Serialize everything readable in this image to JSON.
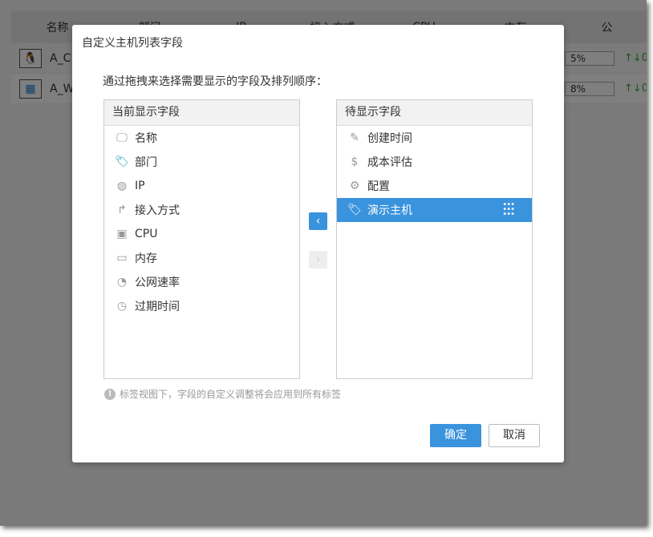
{
  "background": {
    "headers": [
      "名称",
      "部门",
      "IP",
      "接入方式",
      "CPU",
      "内存",
      "公"
    ],
    "rows": [
      {
        "name": "A_C",
        "os": "linux-icon",
        "mem": "5%",
        "net": "↑↓0"
      },
      {
        "name": "A_W",
        "os": "windows-icon",
        "mem": "8%",
        "net": "↑↓0"
      }
    ]
  },
  "dialog": {
    "title": "自定义主机列表字段",
    "instruction": "通过拖拽来选择需要显示的字段及排列顺序：",
    "current": {
      "header": "当前显示字段",
      "items": [
        {
          "label": "名称",
          "icon": "monitor-icon"
        },
        {
          "label": "部门",
          "icon": "tag-icon"
        },
        {
          "label": "IP",
          "icon": "globe-icon"
        },
        {
          "label": "接入方式",
          "icon": "share-icon"
        },
        {
          "label": "CPU",
          "icon": "cpu-icon"
        },
        {
          "label": "内存",
          "icon": "memory-icon"
        },
        {
          "label": "公网速率",
          "icon": "gauge-icon"
        },
        {
          "label": "过期时间",
          "icon": "clock-icon"
        }
      ]
    },
    "pending": {
      "header": "待显示字段",
      "items": [
        {
          "label": "创建时间",
          "icon": "pencil-icon"
        },
        {
          "label": "成本评估",
          "icon": "dollar-icon"
        },
        {
          "label": "配置",
          "icon": "monitor-gear-icon"
        },
        {
          "label": "演示主机",
          "icon": "tag-icon",
          "selected": true
        }
      ]
    },
    "move_left": "‹",
    "move_right": "›",
    "note": "标签视图下，字段的自定义调整将会应用到所有标签",
    "ok": "确定",
    "cancel": "取消"
  },
  "colors": {
    "accent": "#3a93dd",
    "tag": "#1a9bb0"
  }
}
